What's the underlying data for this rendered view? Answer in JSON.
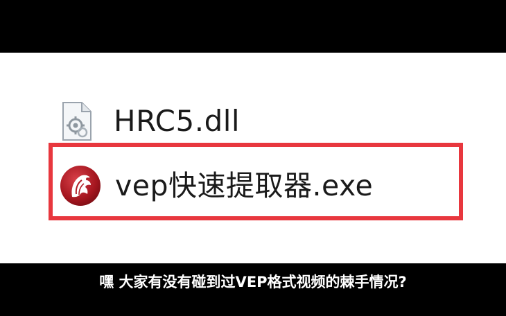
{
  "files": [
    {
      "name": "HRC5.dll",
      "icon": "dll-file-icon",
      "highlighted": false
    },
    {
      "name": "vep快速提取器.exe",
      "icon": "app-exe-icon",
      "highlighted": true
    }
  ],
  "subtitle": "嘿 大家有没有碰到过VEP格式视频的棘手情况?",
  "colors": {
    "highlight": "#e8373e",
    "letterbox": "#000000",
    "background": "#ffffff",
    "icon_red": "#b11e27"
  }
}
